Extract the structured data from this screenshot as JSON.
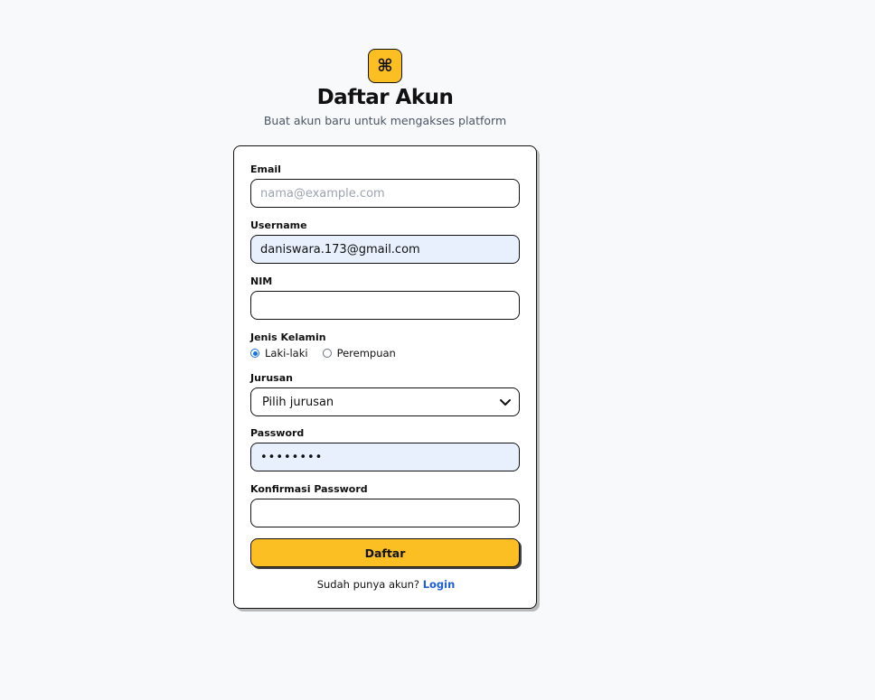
{
  "header": {
    "logo_icon": "command-icon",
    "logo_glyph": "⌘",
    "title": "Daftar Akun",
    "subtitle": "Buat akun baru untuk mengakses platform"
  },
  "form": {
    "email": {
      "label": "Email",
      "value": "",
      "placeholder": "nama@example.com"
    },
    "username": {
      "label": "Username",
      "value": "daniswara.173@gmail.com"
    },
    "nim": {
      "label": "NIM",
      "value": ""
    },
    "gender": {
      "label": "Jenis Kelamin",
      "options": [
        "Laki-laki",
        "Perempuan"
      ],
      "selected": "Laki-laki"
    },
    "jurusan": {
      "label": "Jurusan",
      "selected": "Pilih jurusan"
    },
    "password": {
      "label": "Password",
      "value": "••••••••"
    },
    "confirm_password": {
      "label": "Konfirmasi Password",
      "value": ""
    },
    "submit_label": "Daftar"
  },
  "footer": {
    "prompt": "Sudah punya akun?",
    "link_label": "Login"
  },
  "colors": {
    "background": "#f8f9fb",
    "accent": "#fbbf24",
    "link": "#1d5fd6",
    "autofill": "#e8f0fe"
  }
}
